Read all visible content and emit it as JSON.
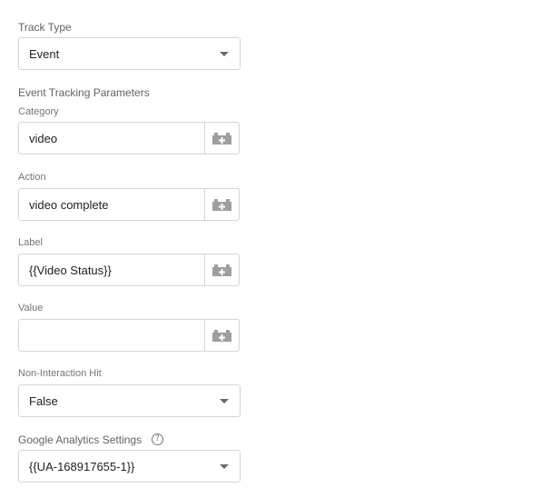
{
  "track_type": {
    "label": "Track Type",
    "value": "Event"
  },
  "event_params": {
    "heading": "Event Tracking Parameters",
    "category": {
      "label": "Category",
      "value": "video"
    },
    "action": {
      "label": "Action",
      "value": "video complete"
    },
    "label": {
      "label": "Label",
      "value": "{{Video Status}}"
    },
    "value": {
      "label": "Value",
      "value": ""
    }
  },
  "non_interaction": {
    "label": "Non-Interaction Hit",
    "value": "False"
  },
  "ga_settings": {
    "label": "Google Analytics Settings",
    "help_glyph": "?",
    "value": "{{UA-168917655-1}}"
  },
  "icons": {
    "dropdown": "chevron-down-icon",
    "variable": "variable-picker-icon",
    "help": "help-icon"
  }
}
